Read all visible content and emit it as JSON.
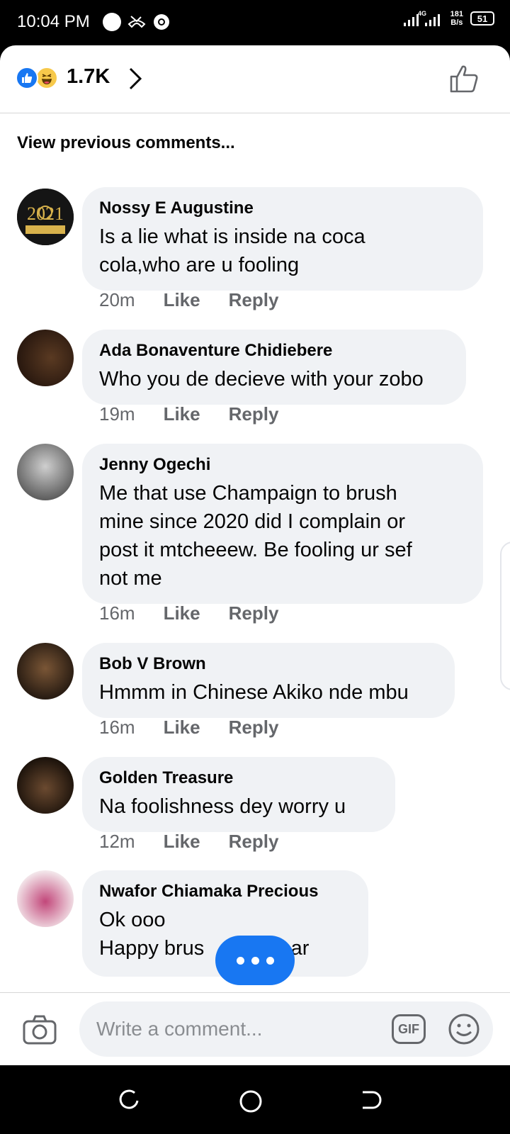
{
  "status": {
    "time": "10:04 PM",
    "network_type": "4G",
    "speed_value": "181",
    "speed_unit": "B/s",
    "battery": "51"
  },
  "reactions": {
    "count": "1.7K"
  },
  "view_previous": "View previous comments...",
  "comments": [
    {
      "author": "Nossy E Augustine",
      "lines": [
        "Is a lie what is inside na coca",
        "cola,who are u fooling"
      ],
      "time": "20m",
      "like": "Like",
      "reply": "Reply",
      "avatar_text": "2021"
    },
    {
      "author": "Ada Bonaventure Chidiebere",
      "lines": [
        "Who you de decieve with your zobo"
      ],
      "time": "19m",
      "like": "Like",
      "reply": "Reply"
    },
    {
      "author": "Jenny Ogechi",
      "lines": [
        "Me that use Champaign to brush",
        "mine since 2020 did I complain or",
        "post it mtcheeew. Be fooling ur sef",
        "not me"
      ],
      "time": "16m",
      "like": "Like",
      "reply": "Reply"
    },
    {
      "author": "Bob V Brown",
      "lines": [
        "Hmmm in Chinese Akiko nde mbu"
      ],
      "time": "16m",
      "like": "Like",
      "reply": "Reply"
    },
    {
      "author": "Golden Treasure",
      "lines": [
        "Na foolishness dey worry u"
      ],
      "time": "12m",
      "like": "Like",
      "reply": "Reply"
    },
    {
      "author": "Nwafor Chiamaka Precious",
      "lines": [
        "Ok ooo",
        "Happy brus",
        "dear"
      ]
    }
  ],
  "composer": {
    "placeholder": "Write a comment...",
    "gif_label": "GIF"
  },
  "colors": {
    "accent": "#1877f2",
    "bubble": "#f0f2f5",
    "meta": "#65676b"
  }
}
